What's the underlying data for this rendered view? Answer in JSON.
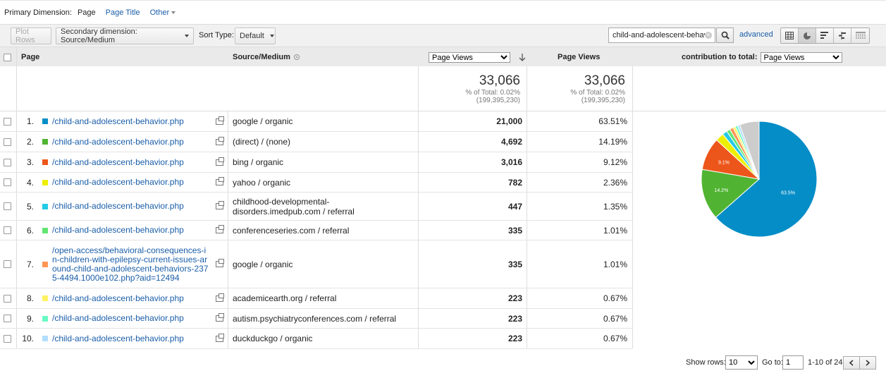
{
  "primary_dimension": {
    "label": "Primary Dimension:",
    "active": "Page",
    "options": [
      "Page Title",
      "Other"
    ]
  },
  "toolbar": {
    "plot_rows": "Plot Rows",
    "secondary_dimension": "Secondary dimension: Source/Medium",
    "sort_type_label": "Sort Type:",
    "sort_type_value": "Default",
    "search_value": "child-and-adolescent-behav",
    "advanced": "advanced"
  },
  "header": {
    "page": "Page",
    "source_medium": "Source/Medium",
    "metric_select": "Page Views",
    "metric_col": "Page Views",
    "contribution_label": "contribution to total:",
    "contribution_select": "Page Views"
  },
  "totals": {
    "col1": {
      "value": "33,066",
      "pct": "% of Total: 0.02%",
      "of": "(199,395,230)"
    },
    "col2": {
      "value": "33,066",
      "pct": "% of Total: 0.02%",
      "of": "(199,395,230)"
    }
  },
  "rows": [
    {
      "num": "1.",
      "page": "/child-and-adolescent-behavior.php",
      "source": "google / organic",
      "views": "21,000",
      "pct": "63.51%",
      "color": "#058dc7"
    },
    {
      "num": "2.",
      "page": "/child-and-adolescent-behavior.php",
      "source": "(direct) / (none)",
      "views": "4,692",
      "pct": "14.19%",
      "color": "#50b432"
    },
    {
      "num": "3.",
      "page": "/child-and-adolescent-behavior.php",
      "source": "bing / organic",
      "views": "3,016",
      "pct": "9.12%",
      "color": "#ed561b"
    },
    {
      "num": "4.",
      "page": "/child-and-adolescent-behavior.php",
      "source": "yahoo / organic",
      "views": "782",
      "pct": "2.36%",
      "color": "#edef00"
    },
    {
      "num": "5.",
      "page": "/child-and-adolescent-behavior.php",
      "source_line1": "childhood-developmental-",
      "source_line2": "disorders.imedpub.com / referral",
      "views": "447",
      "pct": "1.35%",
      "color": "#24cbe5"
    },
    {
      "num": "6.",
      "page": "/child-and-adolescent-behavior.php",
      "source": "conferenceseries.com / referral",
      "views": "335",
      "pct": "1.01%",
      "color": "#64e572"
    },
    {
      "num": "7.",
      "page_lines": [
        "/open-access/behavioral-consequences-i",
        "n-children-with-epilepsy-current-issues-ar",
        "ound-child-and-adolescent-behaviors-237",
        "5-4494.1000e102.php?aid=12494"
      ],
      "source": "google / organic",
      "views": "335",
      "pct": "1.01%",
      "color": "#ff9655"
    },
    {
      "num": "8.",
      "page": "/child-and-adolescent-behavior.php",
      "source": "academicearth.org / referral",
      "views": "223",
      "pct": "0.67%",
      "color": "#fff263"
    },
    {
      "num": "9.",
      "page": "/child-and-adolescent-behavior.php",
      "source": "autism.psychiatryconferences.com / referral",
      "views": "223",
      "pct": "0.67%",
      "color": "#6af9c4"
    },
    {
      "num": "10.",
      "page": "/child-and-adolescent-behavior.php",
      "source": "duckduckgo / organic",
      "views": "223",
      "pct": "0.67%",
      "color": "#b2deff"
    }
  ],
  "chart_data": {
    "type": "pie",
    "values": [
      63.51,
      14.19,
      9.12,
      2.36,
      1.35,
      1.01,
      1.01,
      0.67,
      0.67,
      0.67,
      5.44
    ],
    "colors": [
      "#058dc7",
      "#50b432",
      "#ed561b",
      "#edef00",
      "#24cbe5",
      "#64e572",
      "#ff9655",
      "#fff263",
      "#6af9c4",
      "#b2deff",
      "#cccccc"
    ],
    "slice_labels": [
      "63.5%",
      "14.2%",
      "9.1%"
    ]
  },
  "footer": {
    "show_rows_label": "Show rows:",
    "show_rows_value": "10",
    "goto_label": "Go to:",
    "goto_value": "1",
    "range": "1-10 of 24"
  }
}
